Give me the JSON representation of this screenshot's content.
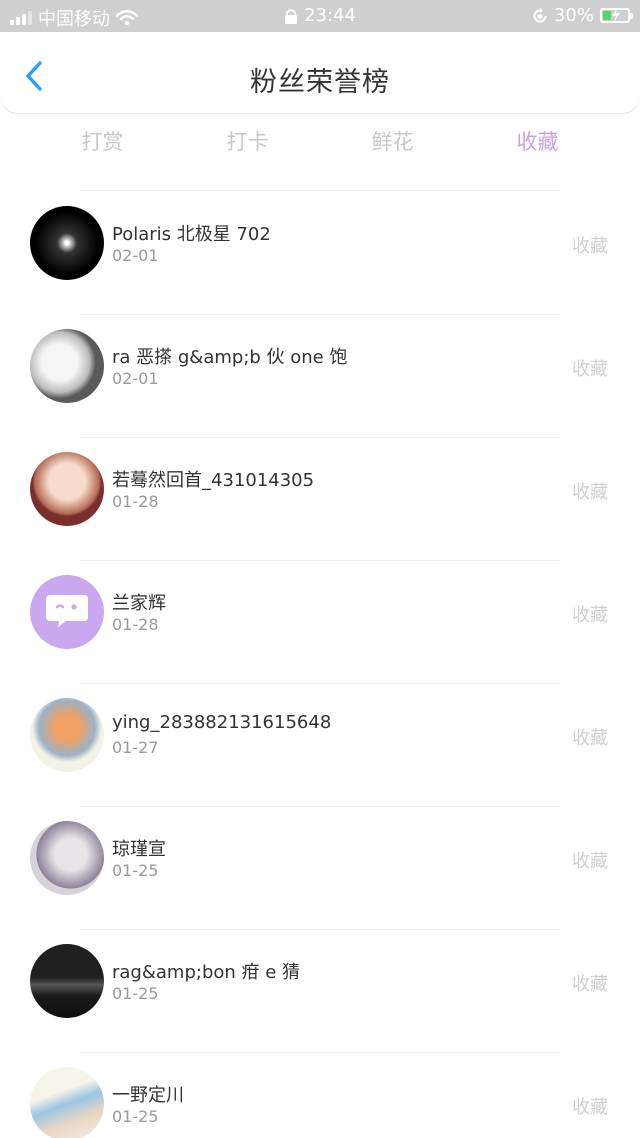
{
  "status_bar": {
    "carrier": "中国移动",
    "time": "23:44",
    "battery": "30%",
    "icons": [
      "signal-icon",
      "wifi-icon",
      "lock-icon",
      "rotation-lock-icon",
      "battery-icon"
    ]
  },
  "header": {
    "title": "粉丝荣誉榜",
    "back_icon": "chevron-left-icon"
  },
  "tabs": [
    {
      "label": "打赏",
      "active": false
    },
    {
      "label": "打卡",
      "active": false
    },
    {
      "label": "鲜花",
      "active": false
    },
    {
      "label": "收藏",
      "active": true
    }
  ],
  "colors": {
    "accent": "#c7a3e6",
    "back_arrow": "#2a9df4",
    "status_bar_bg": "#cfcfcf",
    "muted": "#cfcfcf"
  },
  "fans": [
    {
      "name": "Polaris 北极星 702",
      "date": "02-01",
      "action": "收藏"
    },
    {
      "name": "ra 恶搽 g&amp;b 伙 one 饱",
      "date": "02-01",
      "action": "收藏"
    },
    {
      "name": "若蓦然回首_431014305",
      "date": "01-28",
      "action": "收藏"
    },
    {
      "name": "兰家辉",
      "date": "01-28",
      "action": "收藏"
    },
    {
      "name": "ying_283882131615648",
      "date": "01-27",
      "action": "收藏"
    },
    {
      "name": "琼瑾宣",
      "date": "01-25",
      "action": "收藏"
    },
    {
      "name": "rag&amp;bon 疳 e 猜",
      "date": "01-25",
      "action": "收藏"
    },
    {
      "name": "一野定川",
      "date": "01-25",
      "action": "收藏"
    }
  ]
}
